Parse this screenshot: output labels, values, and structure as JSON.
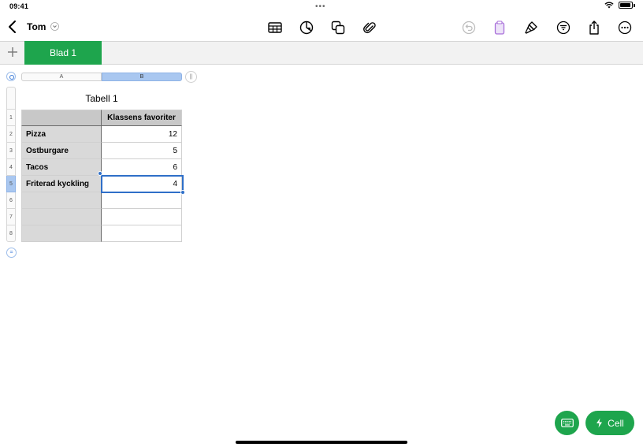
{
  "status": {
    "time": "09:41"
  },
  "nav": {
    "document_title": "Tom",
    "toolbar_icons": [
      "table-icon",
      "chart-icon",
      "shapes-icon",
      "paperclip-icon",
      "undo-icon",
      "paste-icon",
      "paintbrush-icon",
      "filter-icon",
      "share-icon",
      "more-icon"
    ]
  },
  "sheets": {
    "tabs": [
      {
        "label": "Blad 1",
        "active": true
      }
    ]
  },
  "table": {
    "title": "Tabell 1",
    "columns": [
      "A",
      "B"
    ],
    "selected_column": "B",
    "row_numbers": [
      "1",
      "2",
      "3",
      "4",
      "5",
      "6",
      "7",
      "8"
    ],
    "selected_row": "5",
    "rows": [
      {
        "a": "",
        "b": "Klassens favoriter"
      },
      {
        "a": "Pizza",
        "b": "12"
      },
      {
        "a": "Ostburgare",
        "b": "5"
      },
      {
        "a": "Tacos",
        "b": "6"
      },
      {
        "a": "Friterad kyckling",
        "b": "4"
      },
      {
        "a": "",
        "b": ""
      },
      {
        "a": "",
        "b": ""
      },
      {
        "a": "",
        "b": ""
      }
    ]
  },
  "bottom": {
    "cell_button": "Cell"
  },
  "colors": {
    "accent_green": "#1ea54d",
    "selection_blue": "#2f6fc8",
    "header_gray": "#c8c8c8"
  }
}
